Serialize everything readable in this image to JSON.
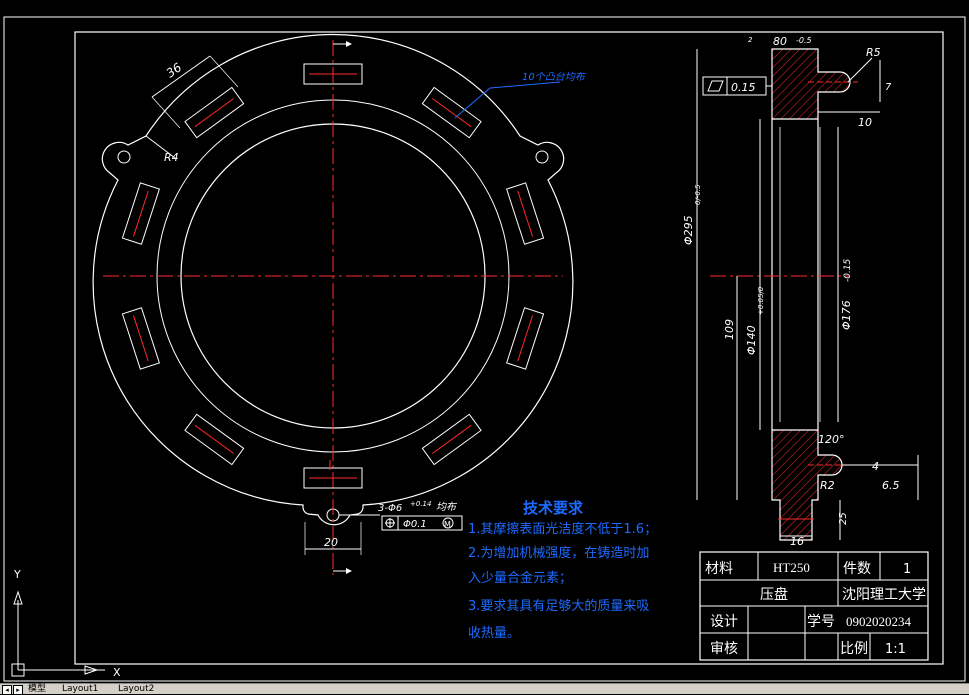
{
  "tabs": {
    "model": "模型",
    "layout1": "Layout1",
    "layout2": "Layout2"
  },
  "ucs": {
    "y_label": "Y",
    "x_label": "X"
  },
  "dimensions": {
    "d36": "36",
    "r4": "R4",
    "d20": "20",
    "boss_note": "10个凸台均布",
    "hole_callout": "3-Φ6",
    "hole_tol": "+0.14",
    "hole_tol_low": "0",
    "hole_equal": "均布",
    "position_frame": "Φ0.1",
    "position_mod": "M",
    "flatness_value": "0.15",
    "side_top": "80",
    "side_top_tol": "-0.5",
    "r5": "R5",
    "d10": "10",
    "d7": "7",
    "d295": "Φ295",
    "d295_tol": "0/-0.5",
    "d109": "109",
    "d140": "Φ140",
    "d140_tol": "+0.05/0",
    "d176": "Φ176",
    "d176_tol": "-0.15",
    "angle120": "120°",
    "d4": "4",
    "r2": "R2",
    "d65": "6.5",
    "d16": "16",
    "d25": "25",
    "small_t": "2"
  },
  "tech_req": {
    "title": "技术要求",
    "line1": "1.其摩擦表面光洁度不低于1.6；",
    "line2": "2.为增加机械强度，在铸造时加",
    "line3": "入少量合金元素；",
    "line4": "3.要求其具有足够大的质量来吸",
    "line5": "收热量。"
  },
  "title_block": {
    "material_label": "材料",
    "material": "HT250",
    "qty_label": "件数",
    "qty": "1",
    "part_name": "压盘",
    "school": "沈阳理工大学",
    "design_label": "设计",
    "id_label": "学号",
    "student_id": "0902020234",
    "review_label": "审核",
    "scale_label": "比例",
    "scale": "1:1"
  }
}
